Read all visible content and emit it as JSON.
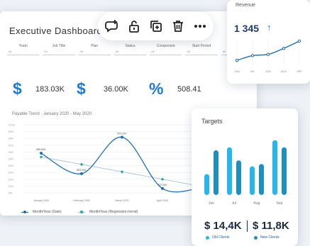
{
  "dashboard": {
    "title": "Executive Dashboard",
    "filters": [
      {
        "label": "Team",
        "value": "All"
      },
      {
        "label": "Job Title",
        "value": "All"
      },
      {
        "label": "Plan",
        "value": "All"
      },
      {
        "label": "Status",
        "value": "All"
      },
      {
        "label": "Component",
        "value": "All"
      },
      {
        "label": "Start Period",
        "value": "All"
      },
      {
        "label": "End",
        "value": "All"
      }
    ],
    "kpis": [
      {
        "icon": "dollar-icon",
        "symbol": "$",
        "value": "183.03K"
      },
      {
        "icon": "dollar-icon",
        "symbol": "$",
        "value": "36.00K"
      },
      {
        "icon": "percent-icon",
        "symbol": "%",
        "value": "508.41"
      }
    ],
    "payable_title": "Payable Trend · January 2020 - May 2020",
    "legend": [
      "Month/Year (Date)",
      "Month/Year (Regression trend)"
    ]
  },
  "toolbar": {
    "icons": [
      "add-comment-icon",
      "lock-icon",
      "copy-add-icon",
      "delete-icon",
      "more-icon"
    ]
  },
  "revenue": {
    "title": "Revenue",
    "value": "1 345",
    "trend": "↑",
    "months": [
      "JAN",
      "JUL",
      "JUN",
      "AUG",
      "SEP"
    ]
  },
  "targets": {
    "title": "Targets",
    "months": [
      "Jun",
      "Jul",
      "Aug",
      "Sep"
    ],
    "old_value": "$ 14,4K",
    "new_value": "$ 11,8K",
    "old_label": "Old Clients",
    "new_label": "New Clients"
  },
  "chart_data": [
    {
      "type": "line",
      "title": "Payable Trend · January 2020 - May 2020",
      "x": [
        "January 2020",
        "February 2020",
        "March 2020",
        "April 2020",
        "May 2020"
      ],
      "series": [
        {
          "name": "Month/Year (Date)",
          "values": [
            6.4,
            3.1,
            9.0,
            0.7,
            0.9
          ]
        },
        {
          "name": "Month/Year (Regression trend)",
          "values": [
            5.8,
            4.6,
            3.4,
            2.2,
            1.0
          ]
        }
      ],
      "data_labels": [
        "$96.60K",
        "$33.00K",
        "$70.62K",
        "$22.00K",
        "$5.00K"
      ],
      "ylim": [
        0,
        11
      ],
      "grid": true,
      "colors": [
        "#1f6fb2",
        "#a9bfd6"
      ]
    },
    {
      "type": "line",
      "title": "Revenue",
      "x": [
        "JAN",
        "JUL",
        "JUN",
        "AUG",
        "SEP"
      ],
      "series": [
        {
          "values": [
            2,
            4,
            4.5,
            7,
            10
          ]
        }
      ],
      "colors": [
        "#1f6fb2"
      ]
    },
    {
      "type": "bar",
      "title": "Targets",
      "categories": [
        "Jun",
        "Jul",
        "Aug",
        "Sep"
      ],
      "series": [
        {
          "name": "Old Clients",
          "values": [
            35,
            80,
            48,
            92
          ]
        },
        {
          "name": "New Clients",
          "values": [
            75,
            58,
            52,
            80
          ]
        }
      ],
      "colors": [
        "#29b6e8",
        "#1d8fc0"
      ]
    }
  ]
}
